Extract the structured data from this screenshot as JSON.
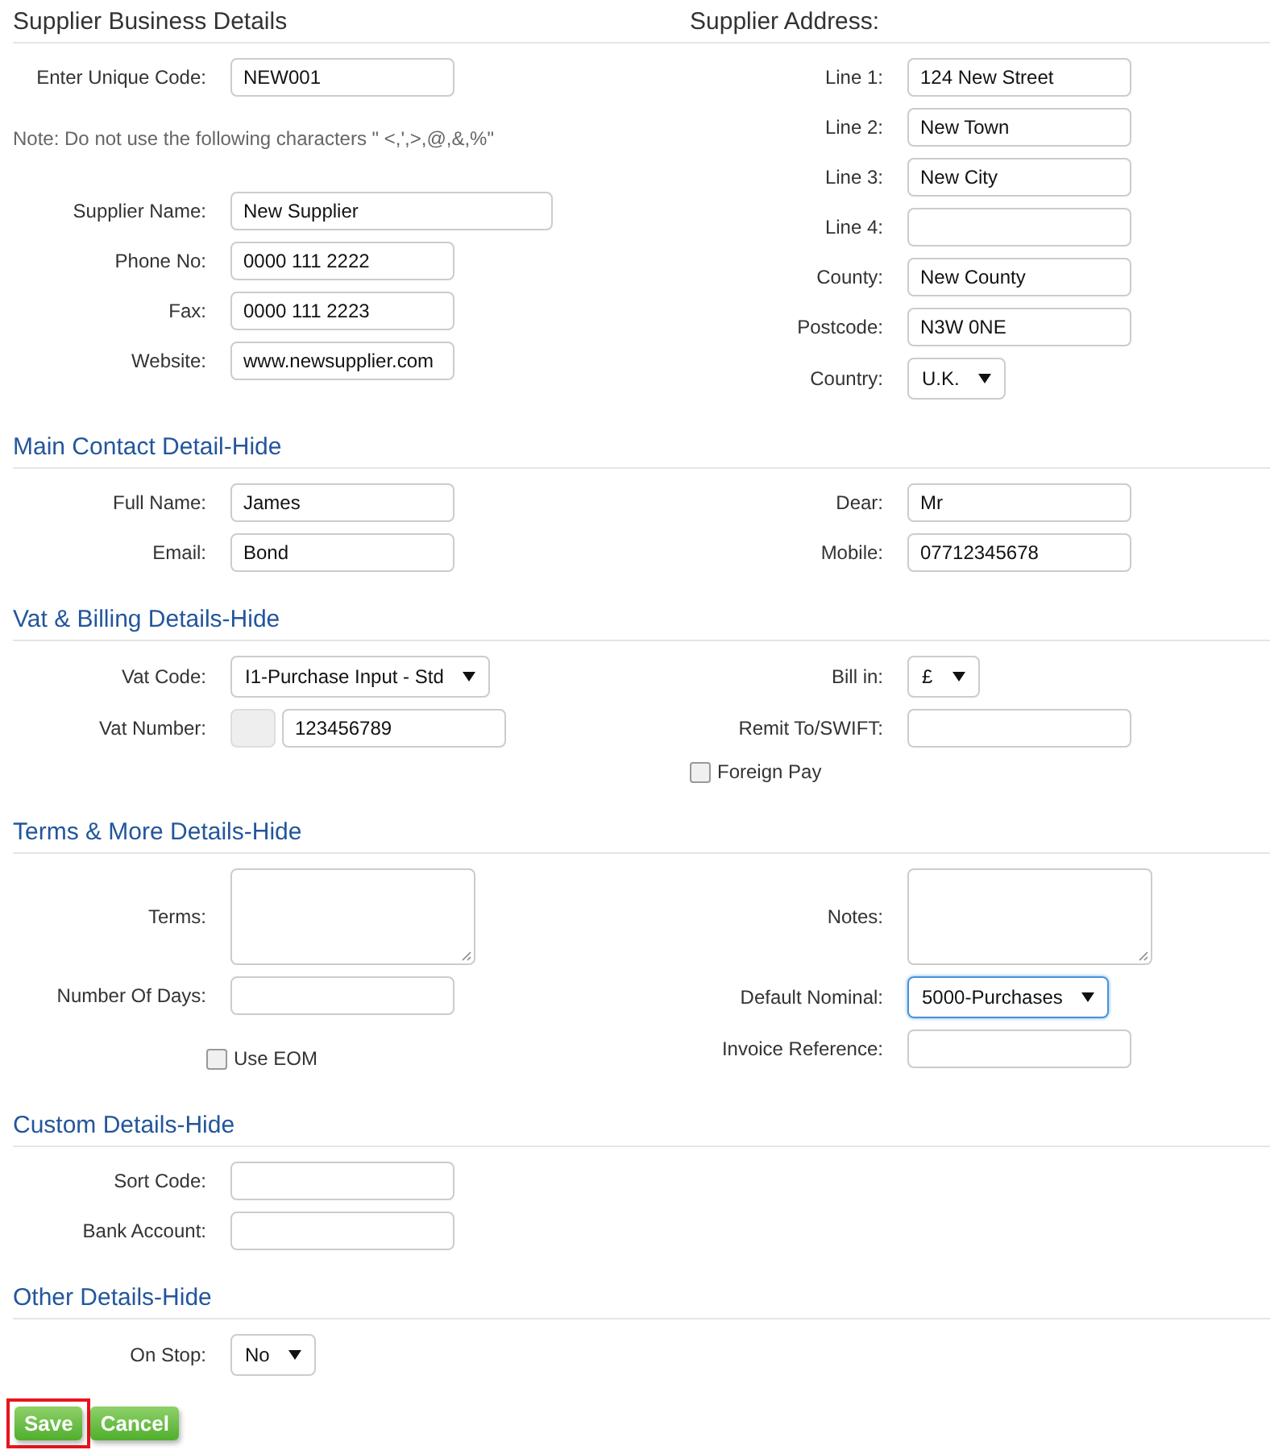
{
  "sections": [
    {
      "kind": "split",
      "titles": [
        "Supplier Business Details",
        "Supplier Address:"
      ],
      "left": [
        {
          "kind": "text",
          "label": "Enter Unique Code:",
          "value": "NEW001"
        },
        {
          "kind": "note",
          "text": "Note: Do not use the following characters \" <,',>,@,&,%\""
        },
        {
          "kind": "text-wide",
          "label": "Supplier Name:",
          "value": "New Supplier"
        },
        {
          "kind": "text",
          "label": "Phone No:",
          "value": "0000 111 2222"
        },
        {
          "kind": "text",
          "label": "Fax:",
          "value": "0000 111 2223"
        },
        {
          "kind": "text",
          "label": "Website:",
          "value": "www.newsupplier.com"
        }
      ],
      "right": [
        {
          "kind": "text",
          "label": "Line 1:",
          "value": "124 New Street"
        },
        {
          "kind": "text",
          "label": "Line 2:",
          "value": "New Town"
        },
        {
          "kind": "text",
          "label": "Line 3:",
          "value": "New City"
        },
        {
          "kind": "text",
          "label": "Line 4:"
        },
        {
          "kind": "text",
          "label": "County:",
          "value": "New County"
        },
        {
          "kind": "text",
          "label": "Postcode:",
          "value": "N3W 0NE"
        },
        {
          "kind": "select",
          "label": "Country:",
          "value": "U.K.",
          "focused": false
        }
      ]
    },
    {
      "kind": "toggle",
      "title": "Main Contact Detail-Hide",
      "left": [
        {
          "kind": "text",
          "label": "Full Name:",
          "value": "James"
        },
        {
          "kind": "text",
          "label": "Email:",
          "value": "Bond"
        }
      ],
      "right": [
        {
          "kind": "text",
          "label": "Dear:",
          "value": "Mr"
        },
        {
          "kind": "text",
          "label": "Mobile:",
          "value": "07712345678"
        }
      ]
    },
    {
      "kind": "toggle",
      "title": "Vat & Billing Details-Hide",
      "left": [
        {
          "kind": "select",
          "label": "Vat Code:",
          "value": "I1-Purchase Input - Std",
          "focused": false
        },
        {
          "kind": "prefixed",
          "label": "Vat Number:",
          "value": "123456789"
        }
      ],
      "right": [
        {
          "kind": "select",
          "label": "Bill in:",
          "value": "£",
          "focused": false
        },
        {
          "kind": "text",
          "label": "Remit To/SWIFT:"
        },
        {
          "kind": "checkbox",
          "label": "Foreign Pay",
          "checked": false
        }
      ]
    },
    {
      "kind": "toggle",
      "title": "Terms & More Details-Hide",
      "left": [
        {
          "kind": "textarea",
          "label": "Terms:"
        },
        {
          "kind": "text",
          "label": "Number Of Days:"
        },
        {
          "kind": "checkbox",
          "label": "Use EOM",
          "checked": false
        }
      ],
      "right": [
        {
          "kind": "textarea",
          "label": "Notes:"
        },
        {
          "kind": "select",
          "label": "Default Nominal:",
          "value": "5000-Purchases",
          "focused": true
        },
        {
          "kind": "text",
          "label": "Invoice Reference:"
        }
      ]
    },
    {
      "kind": "toggle",
      "title": "Custom Details-Hide",
      "left": [
        {
          "kind": "text",
          "label": "Sort Code:"
        },
        {
          "kind": "text",
          "label": "Bank Account:"
        }
      ]
    },
    {
      "kind": "toggle",
      "title": "Other Details-Hide",
      "left": [
        {
          "kind": "select",
          "label": "On Stop:",
          "value": "No",
          "focused": false
        }
      ]
    }
  ],
  "buttons": [
    {
      "label": "Save",
      "highlighted": true
    },
    {
      "label": "Cancel",
      "highlighted": false
    }
  ]
}
